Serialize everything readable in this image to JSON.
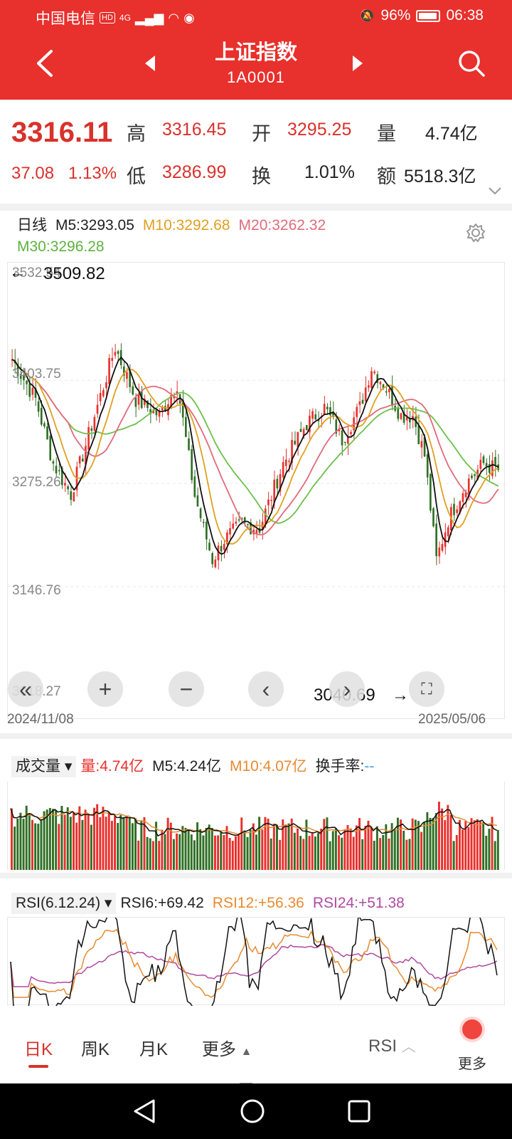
{
  "status_bar": {
    "carrier": "中国电信",
    "hd_badge": "HD",
    "network": "4G",
    "battery_pct": "96%",
    "battery_level": 0.96,
    "time": "06:38"
  },
  "header": {
    "title": "上证指数",
    "code": "1A0001"
  },
  "quote": {
    "price": "3316.11",
    "change": "37.08",
    "change_pct": "1.13%",
    "high_label": "高",
    "high": "3316.45",
    "open_label": "开",
    "open": "3295.25",
    "volume_label": "量",
    "volume": "4.74亿",
    "low_label": "低",
    "low": "3286.99",
    "turnover_label": "换",
    "turnover": "1.01%",
    "amount_label": "额",
    "amount": "5518.3亿"
  },
  "chart": {
    "period": "日线",
    "ma5": "M5:3293.05",
    "ma10": "M10:3292.68",
    "ma20": "M20:3262.32",
    "ma30": "M30:3296.28",
    "y_top": "3532.54",
    "y_2": "3403.75",
    "y_3": "3275.26",
    "y_4": "3146.76",
    "y_bottom": "3018.27",
    "high_annotation": "3509.82",
    "low_annotation": "3040.69",
    "start_date": "2024/11/08",
    "end_date": "2025/05/06",
    "colors": {
      "up": "#e8302c",
      "down": "#2f6f24",
      "ma5": "#111111",
      "ma10": "#e0a020",
      "ma20": "#e26a7a",
      "ma30": "#6cc04a"
    }
  },
  "volume": {
    "selector": "成交量",
    "vol": "量:4.74亿",
    "m5": "M5:4.24亿",
    "m10": "M10:4.07亿",
    "turnover_rate_label": "换手率:",
    "turnover_rate_value": "--"
  },
  "rsi": {
    "selector": "RSI(6.12.24)",
    "rsi6": "RSI6:+69.42",
    "rsi12": "RSI12:+56.36",
    "rsi24": "RSI24:+51.38"
  },
  "tabs": {
    "daily": "日K",
    "weekly": "周K",
    "monthly": "月K",
    "more": "更多",
    "indicator": "RSI",
    "more_right": "更多"
  },
  "chart_data": {
    "type": "line",
    "x_range": [
      "2024/11/08",
      "2025/05/06"
    ],
    "ylim": [
      3018.27,
      3532.54
    ],
    "y_ticks": [
      3532.54,
      3403.75,
      3275.26,
      3146.76,
      3018.27
    ],
    "annotations": [
      {
        "label": "3509.82",
        "kind": "high"
      },
      {
        "label": "3040.69",
        "kind": "low"
      }
    ],
    "series": [
      {
        "name": "M5",
        "last": 3293.05
      },
      {
        "name": "M10",
        "last": 3292.68
      },
      {
        "name": "M20",
        "last": 3262.32
      },
      {
        "name": "M30",
        "last": 3296.28
      }
    ]
  }
}
